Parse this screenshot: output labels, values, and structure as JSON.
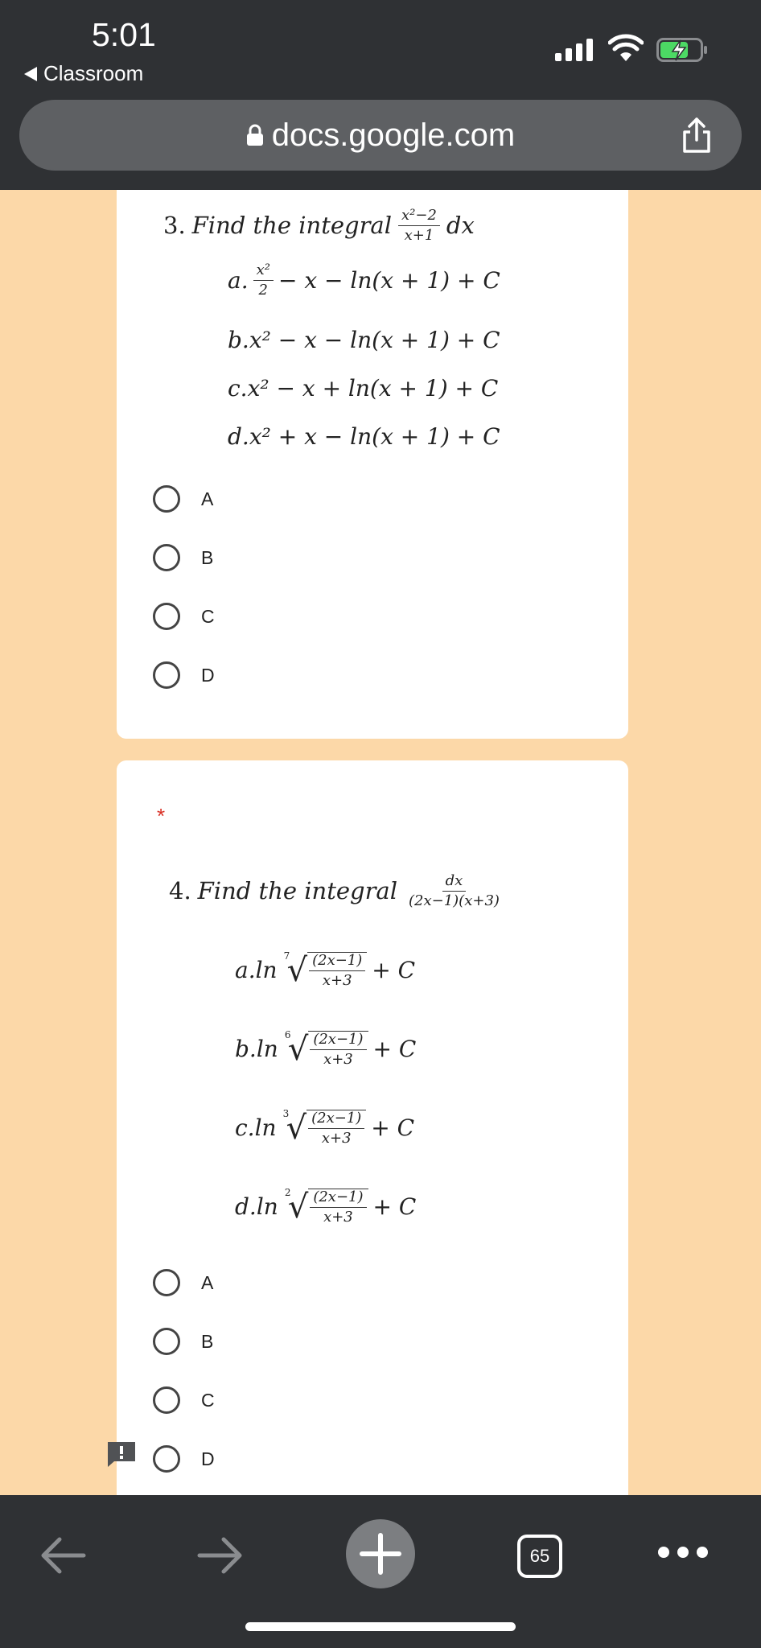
{
  "status": {
    "time": "5:01",
    "back_app": "Classroom"
  },
  "browser": {
    "url": "docs.google.com",
    "tab_count": "65"
  },
  "q3": {
    "number": "3.",
    "title": "Find the integral",
    "integrand_num": "x²−2",
    "integrand_den": "x+1",
    "dx": "dx",
    "options": [
      {
        "label": "a.",
        "pre_num": "x²",
        "pre_den": "2",
        "text": "− x − ln(x + 1) + C"
      },
      {
        "label": "b.",
        "text": "x² − x − ln(x + 1) + C"
      },
      {
        "label": "c.",
        "text": "x² − x + ln(x + 1) + C"
      },
      {
        "label": "d.",
        "text": "x² + x − ln(x + 1) + C"
      }
    ],
    "choices": [
      "A",
      "B",
      "C",
      "D"
    ]
  },
  "q4": {
    "required_mark": "*",
    "number": "4.",
    "title": "Find the integral",
    "integrand_num": "dx",
    "integrand_den": "(2x−1)(x+3)",
    "options": [
      {
        "label": "a.",
        "ln": "ln",
        "index": "7",
        "num": "(2x−1)",
        "den": "x+3",
        "tail": "+ C"
      },
      {
        "label": "b.",
        "ln": "ln",
        "index": "6",
        "num": "(2x−1)",
        "den": "x+3",
        "tail": "+ C"
      },
      {
        "label": "c.",
        "ln": "ln",
        "index": "3",
        "num": "(2x−1)",
        "den": "x+3",
        "tail": "+ C"
      },
      {
        "label": "d.",
        "ln": "ln",
        "index": "2",
        "num": "(2x−1)",
        "den": "x+3",
        "tail": "+ C"
      }
    ],
    "choices": [
      "A",
      "B",
      "C",
      "D"
    ]
  },
  "colors": {
    "page_bg": "#fcd8a8",
    "bar_bg": "#2f3134",
    "required": "#d93025"
  }
}
